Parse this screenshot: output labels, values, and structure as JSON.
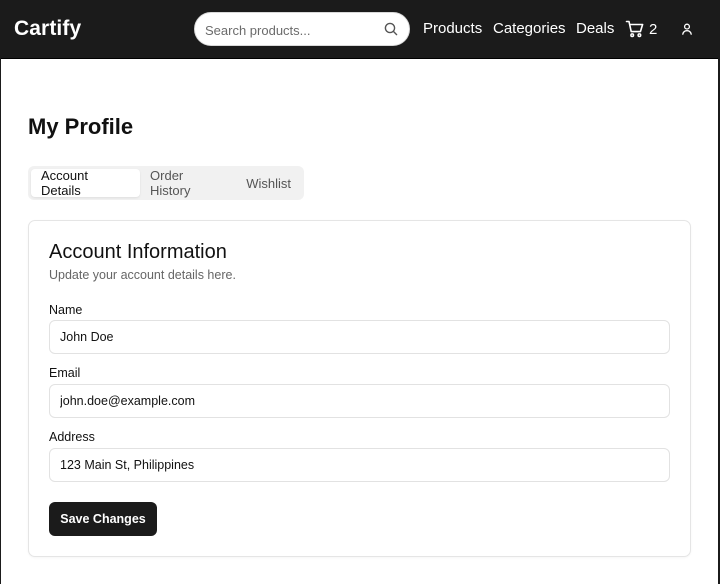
{
  "header": {
    "brand": "Cartify",
    "search": {
      "placeholder": "Search products...",
      "value": ""
    },
    "nav": [
      {
        "label": "Products"
      },
      {
        "label": "Categories"
      },
      {
        "label": "Deals"
      }
    ],
    "cart_count": "2",
    "icons": {
      "search": "search-icon",
      "cart": "cart-icon",
      "user": "user-icon"
    }
  },
  "page": {
    "title": "My Profile",
    "tabs": [
      {
        "label": "Account Details",
        "active": true
      },
      {
        "label": "Order History",
        "active": false
      },
      {
        "label": "Wishlist",
        "active": false
      }
    ]
  },
  "account": {
    "title": "Account Information",
    "subtitle": "Update your account details here.",
    "fields": {
      "name": {
        "label": "Name",
        "value": "John Doe"
      },
      "email": {
        "label": "Email",
        "value": "john.doe@example.com"
      },
      "address": {
        "label": "Address",
        "value": "123 Main St, Philippines"
      }
    },
    "save_label": "Save Changes"
  },
  "colors": {
    "header_bg": "#1b1b1b",
    "accent": "#1b1b1b",
    "border": "#e5e5e5",
    "muted_text": "#666666"
  }
}
